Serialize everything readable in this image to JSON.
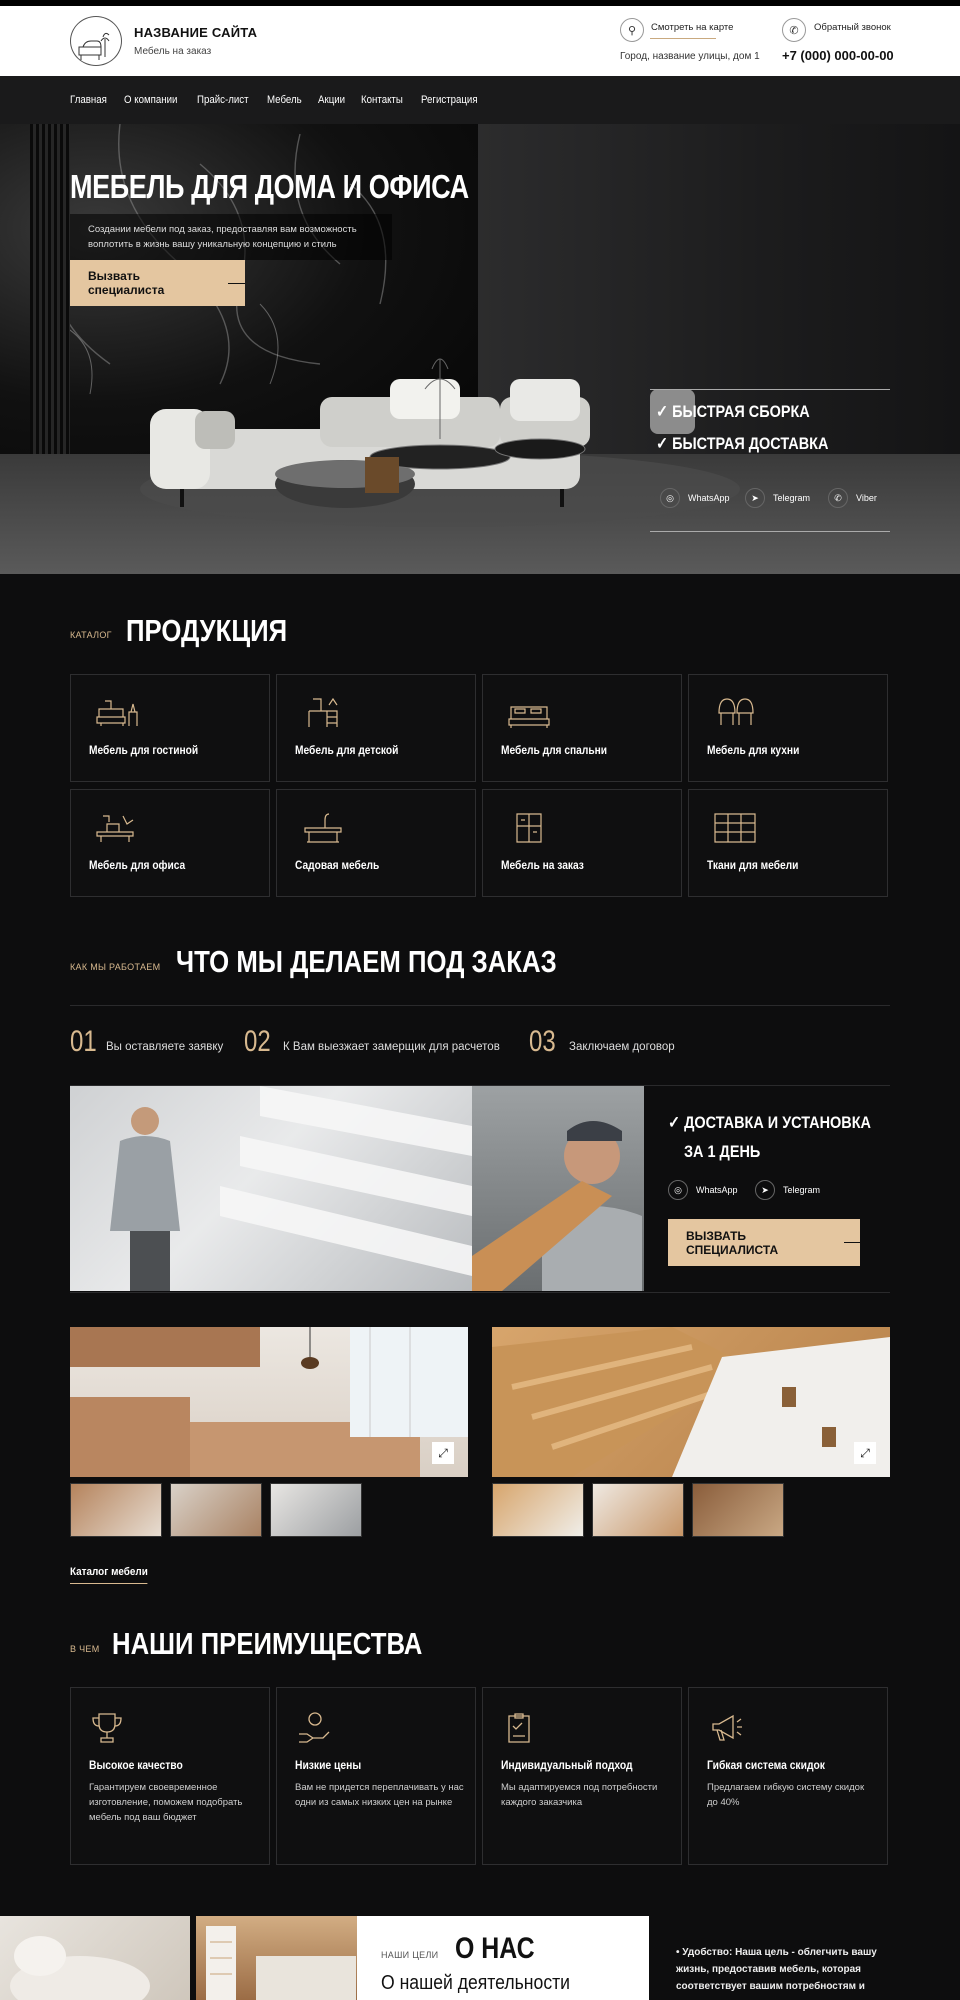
{
  "header": {
    "site_name": "НАЗВАНИЕ САЙТА",
    "site_sub": "Мебель на заказ",
    "map_link": "Смотреть на карте",
    "address": "Город, название улицы, дом 1",
    "callback_link": "Обратный звонок",
    "phone": "+7 (000) 000-00-00"
  },
  "nav": {
    "items": [
      "Главная",
      "О компании",
      "Прайс-лист",
      "Мебель",
      "Акции",
      "Контакты",
      "Регистрация"
    ]
  },
  "hero": {
    "title": "МЕБЕЛЬ ДЛЯ ДОМА И ОФИСА",
    "desc": "Создании мебели под заказ, предоставляя вам возможность воплотить в жизнь вашу уникальную концепцию и стиль",
    "button": "Вызвать специалиста",
    "features": [
      "БЫСТРАЯ СБОРКА",
      "БЫСТРАЯ ДОСТАВКА"
    ],
    "socials": [
      "WhatsApp",
      "Telegram",
      "Viber"
    ]
  },
  "catalog": {
    "kicker": "КАТАЛОГ",
    "title": "ПРОДУКЦИЯ",
    "items": [
      {
        "label": "Мебель для гостиной",
        "icon": "sofa-icon"
      },
      {
        "label": "Мебель для детской",
        "icon": "kids-desk-icon"
      },
      {
        "label": "Мебель для спальни",
        "icon": "bed-icon"
      },
      {
        "label": "Мебель для кухни",
        "icon": "chairs-icon"
      },
      {
        "label": "Мебель для офиса",
        "icon": "office-chair-icon"
      },
      {
        "label": "Садовая мебель",
        "icon": "garden-table-icon"
      },
      {
        "label": "Мебель на заказ",
        "icon": "cabinet-icon"
      },
      {
        "label": "Ткани для мебели",
        "icon": "fabric-icon"
      }
    ]
  },
  "process": {
    "kicker": "КАК МЫ РАБОТАЕМ",
    "title": "ЧТО МЫ ДЕЛАЕМ ПОД ЗАКАЗ",
    "steps": [
      {
        "num": "01",
        "text": "Вы оставляете заявку"
      },
      {
        "num": "02",
        "text": "К Вам выезжает замерщик для расчетов"
      },
      {
        "num": "03",
        "text": "Заключаем договор"
      }
    ],
    "delivery_title_1": "ДОСТАВКА И УСТАНОВКА",
    "delivery_title_2": "ЗА 1 ДЕНЬ",
    "socials": [
      "WhatsApp",
      "Telegram"
    ],
    "button": "ВЫЗВАТЬ СПЕЦИАЛИСТА",
    "catalog_link": "Каталог мебели"
  },
  "advantages": {
    "kicker": "В ЧЕМ",
    "title": "НАШИ ПРЕИМУЩЕСТВА",
    "items": [
      {
        "title": "Высокое качество",
        "text": "Гарантируем своевременное изготовление, поможем подобрать мебель под ваш бюджет",
        "icon": "trophy-icon"
      },
      {
        "title": "Низкие цены",
        "text": "Вам не придется переплачивать у нас одни из самых низких цен на рынке",
        "icon": "coin-hand-icon"
      },
      {
        "title": "Индивидуальный подход",
        "text": "Мы адаптируемся под потребности каждого заказчика",
        "icon": "clipboard-icon"
      },
      {
        "title": "Гибкая система скидок",
        "text": "Предлагаем гибкую систему скидок до 40%",
        "icon": "megaphone-icon"
      }
    ]
  },
  "about": {
    "kicker": "НАШИ ЦЕЛИ",
    "title": "О НАС",
    "subtitle": "О нашей деятельности",
    "text": "Удобство: Наша цель - облегчить вашу жизнь, предоставив мебель, которая соответствует вашим потребностям и"
  },
  "colors": {
    "accent": "#e4c6a0",
    "gold_text": "#d8b98f",
    "bg": "#0d0d0e"
  }
}
